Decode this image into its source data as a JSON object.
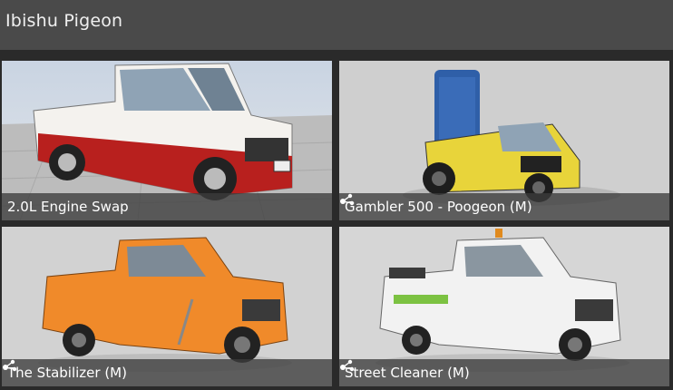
{
  "header": {
    "title": "Ibishu Pigeon"
  },
  "configs": [
    {
      "label": "2.0L Engine Swap",
      "is_mod": false,
      "body_color": "#f4f2ee",
      "trim_color": "#b8201e"
    },
    {
      "label": "Gambler 500 - Poogeon (M)",
      "is_mod": true,
      "body_color": "#e8d43a",
      "cargo_color": "#2f5fa8"
    },
    {
      "label": "The Stabilizer (M)",
      "is_mod": true,
      "body_color": "#f08a2a"
    },
    {
      "label": "Street Cleaner (M)",
      "is_mod": true,
      "body_color": "#f2f2f2",
      "accent_color": "#7cc242"
    }
  ],
  "icons": {
    "mod_icon": "mod-share-icon"
  }
}
